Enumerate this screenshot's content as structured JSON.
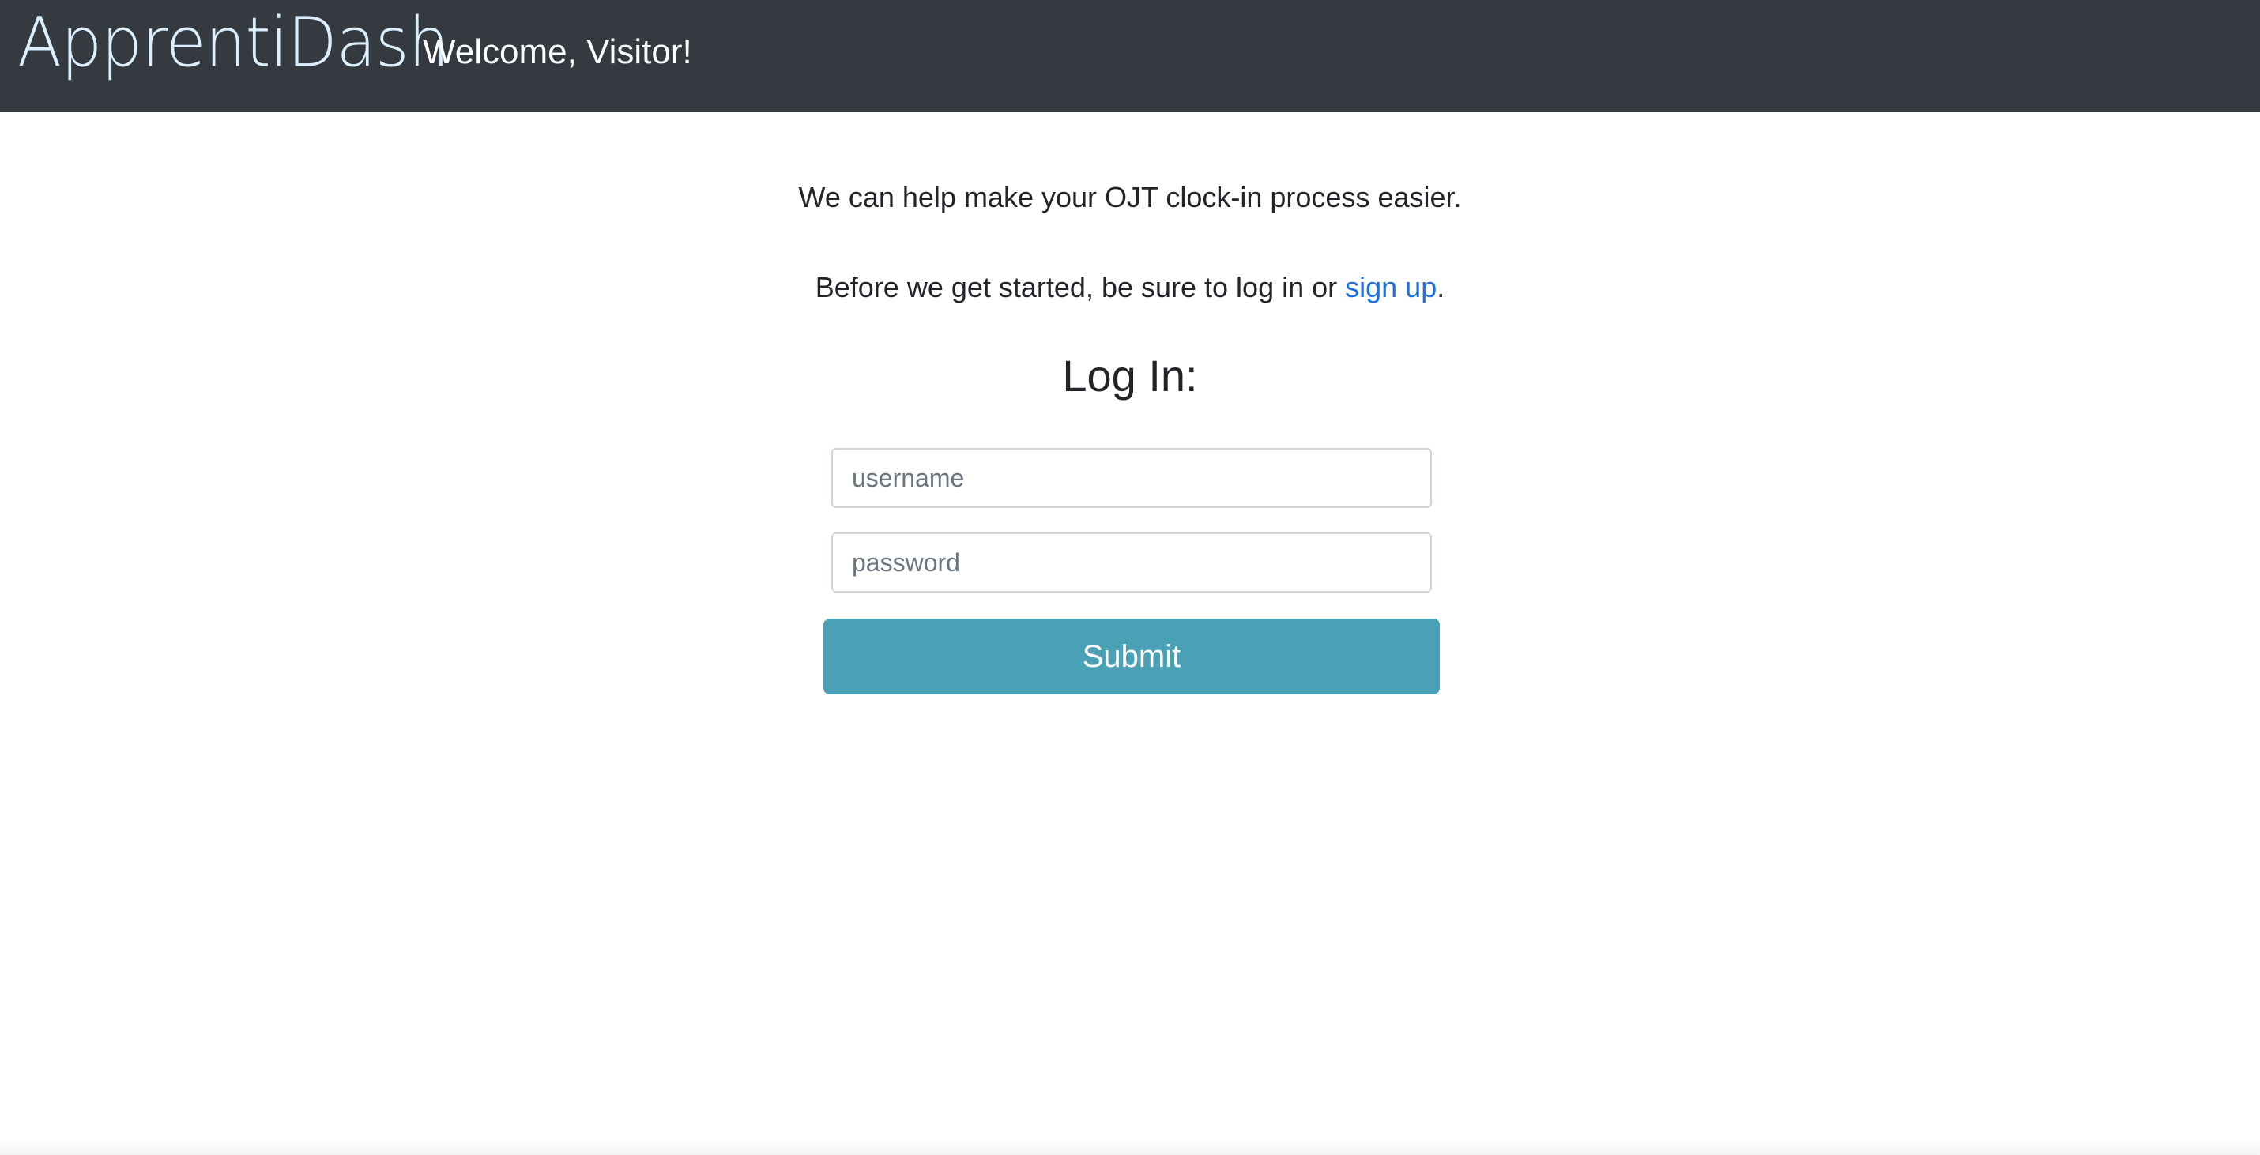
{
  "header": {
    "brand": "ApprentiDash",
    "welcome": "Welcome, Visitor!"
  },
  "main": {
    "intro_line_1": "We can help make your OJT clock-in process easier.",
    "intro_line_2_prefix": "Before we get started, be sure to log in or ",
    "signup_link": "sign up",
    "intro_line_2_suffix": ".",
    "login_heading": "Log In:",
    "username_placeholder": "username",
    "password_placeholder": "password",
    "submit_label": "Submit"
  },
  "colors": {
    "navbar": "#343a40",
    "link": "#1b6fe0",
    "submit": "#4aa0b5"
  }
}
